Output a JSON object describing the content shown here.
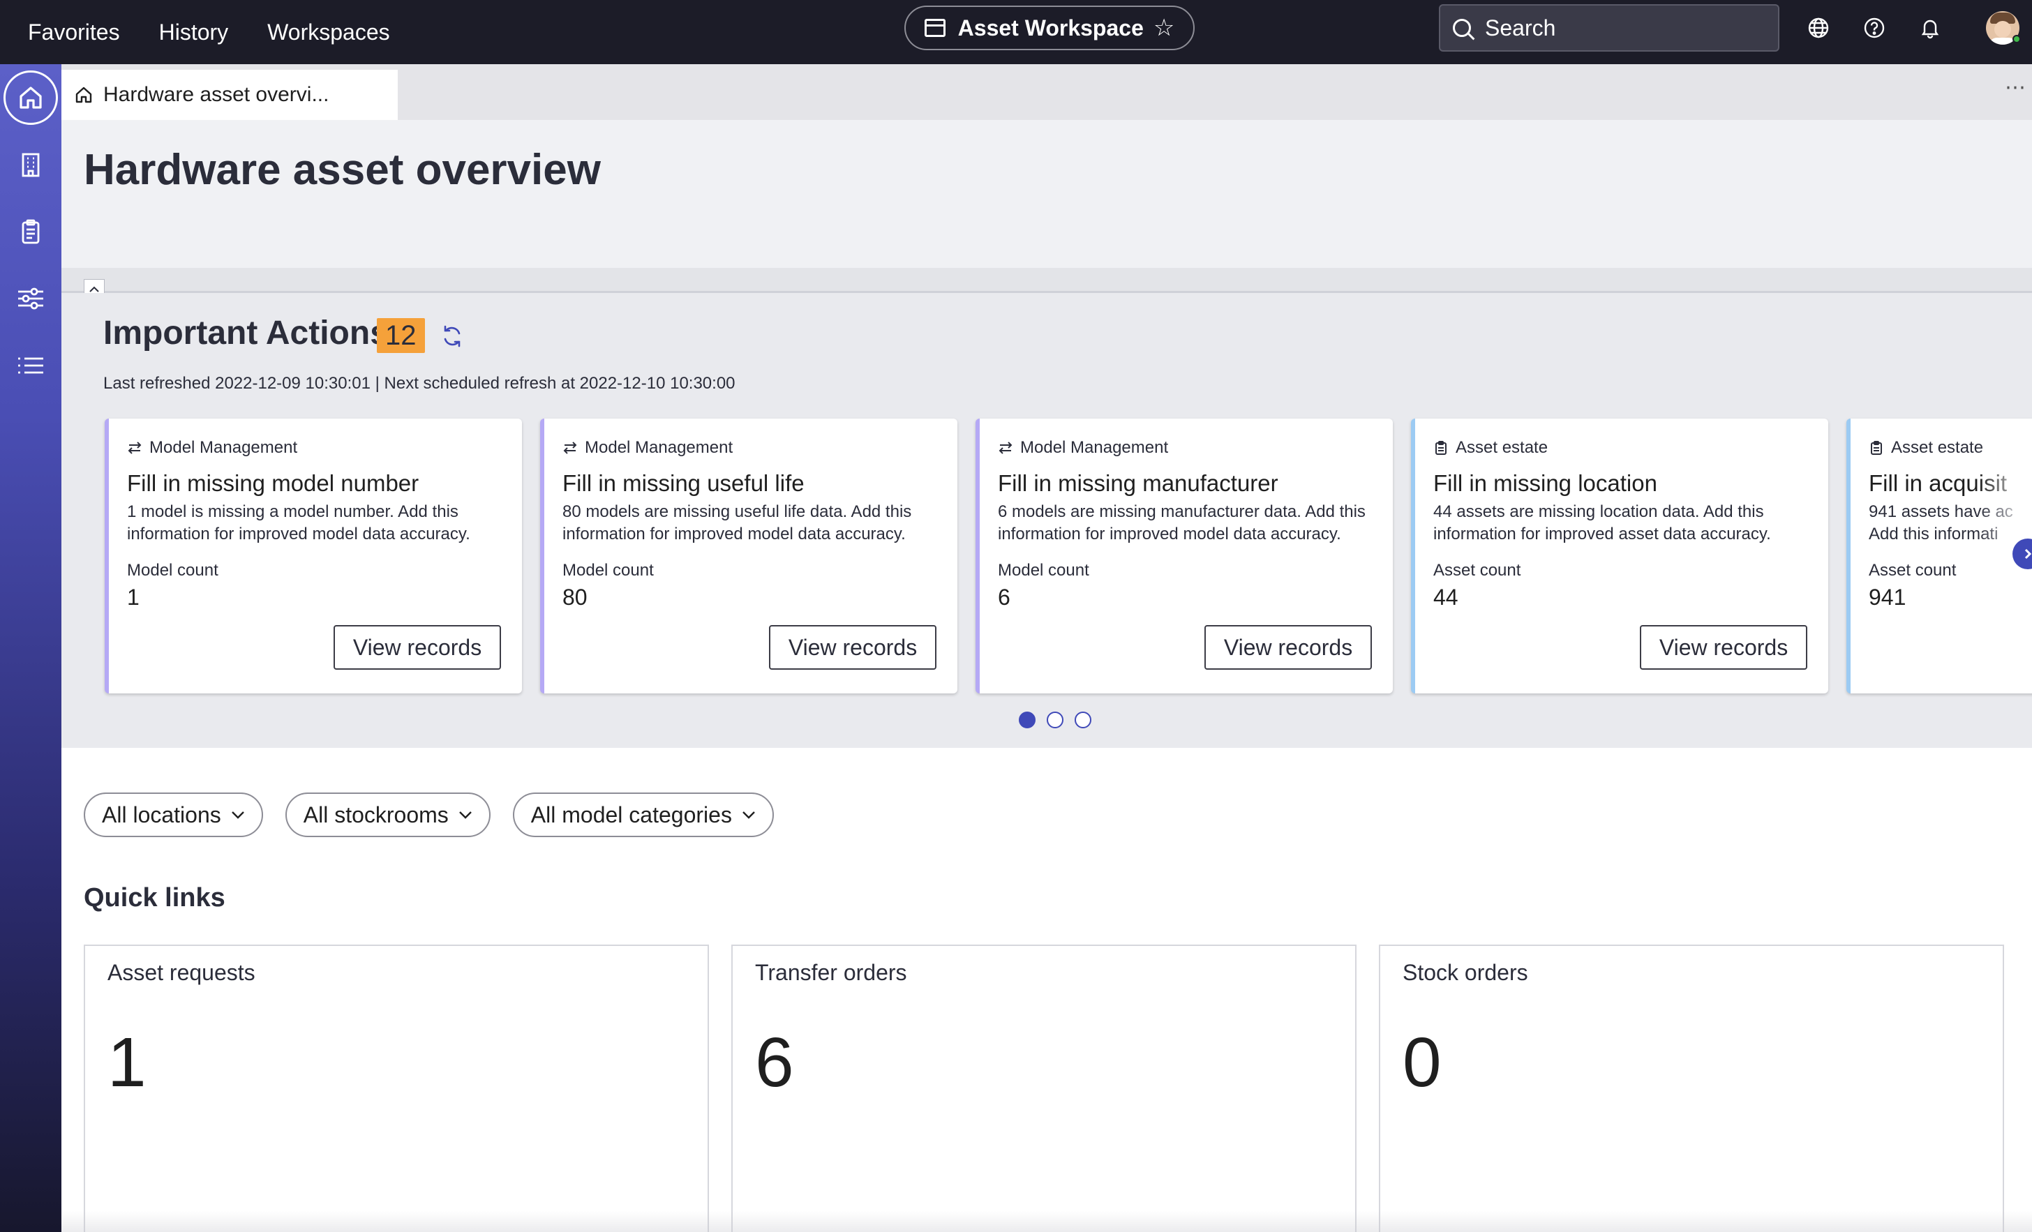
{
  "topbar": {
    "nav": [
      "Favorites",
      "History",
      "Workspaces"
    ],
    "workspace_title": "Asset Workspace",
    "search_placeholder": "Search"
  },
  "tab": {
    "label": "Hardware asset overvi...",
    "more": "⋯"
  },
  "page": {
    "title": "Hardware asset overview"
  },
  "important_actions": {
    "title": "Important Actions",
    "count": "12",
    "meta": "Last refreshed 2022-12-09 10:30:01 | Next scheduled refresh at 2022-12-10 10:30:00",
    "cards": [
      {
        "category": "Model Management",
        "title": "Fill in missing model number",
        "description": "1 model is missing a model number. Add this information for improved model data accuracy.",
        "count_label": "Model count",
        "count": "1",
        "button": "View records"
      },
      {
        "category": "Model Management",
        "title": "Fill in missing useful life",
        "description": "80 models are missing useful life data. Add this information for improved model data accuracy.",
        "count_label": "Model count",
        "count": "80",
        "button": "View records"
      },
      {
        "category": "Model Management",
        "title": "Fill in missing manufacturer",
        "description": "6 models are missing manufacturer data. Add this information for improved model data accuracy.",
        "count_label": "Model count",
        "count": "6",
        "button": "View records"
      },
      {
        "category": "Asset estate",
        "title": "Fill in missing location",
        "description": "44 assets are missing location data. Add this information for improved asset data accuracy.",
        "count_label": "Asset count",
        "count": "44",
        "button": "View records"
      },
      {
        "category": "Asset estate",
        "title": "Fill in acquisit",
        "description": "941 assets have ac Add this informati",
        "count_label": "Asset count",
        "count": "941"
      }
    ]
  },
  "filters": [
    "All locations",
    "All stockrooms",
    "All model categories"
  ],
  "quick_links": {
    "title": "Quick links",
    "items": [
      {
        "label": "Asset requests",
        "value": "1"
      },
      {
        "label": "Transfer orders",
        "value": "6"
      },
      {
        "label": "Stock orders",
        "value": "0"
      }
    ]
  },
  "colors": {
    "topbar": "#1c1c28",
    "accent": "#3f49b8",
    "badge": "#f5a13a",
    "card_border_model": "#b5a9f5",
    "card_border_estate": "#9ccbf3"
  },
  "icons": {
    "home": "home-icon",
    "rail": [
      "building-icon",
      "clipboard-icon",
      "sliders-icon",
      "list-icon"
    ],
    "top": [
      "globe-icon",
      "help-icon",
      "bell-icon"
    ]
  }
}
